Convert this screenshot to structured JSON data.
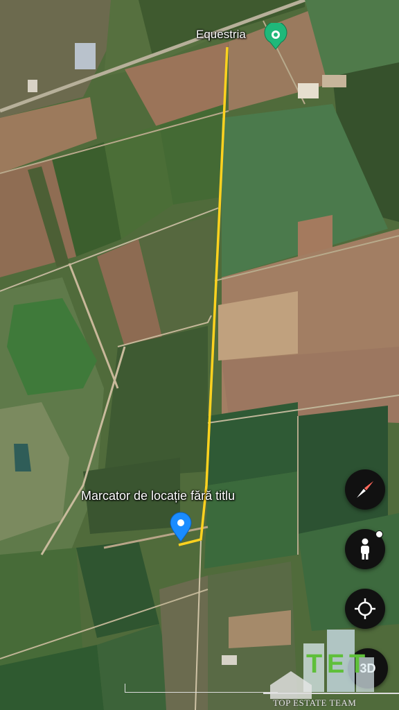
{
  "map": {
    "place_label": "Equestria",
    "marker_label": "Marcator de locație fără titlu"
  },
  "controls": {
    "compass_icon": "compass-icon",
    "street_view_icon": "pegman-icon",
    "location_icon": "my-location-icon",
    "view_3d_label": "3D"
  },
  "watermark": {
    "text": "TOP ESTATE TEAM"
  },
  "colors": {
    "route_line": "#ffd21f",
    "equestria_pin": "#1fb87a",
    "location_marker": "#1a8cff"
  }
}
